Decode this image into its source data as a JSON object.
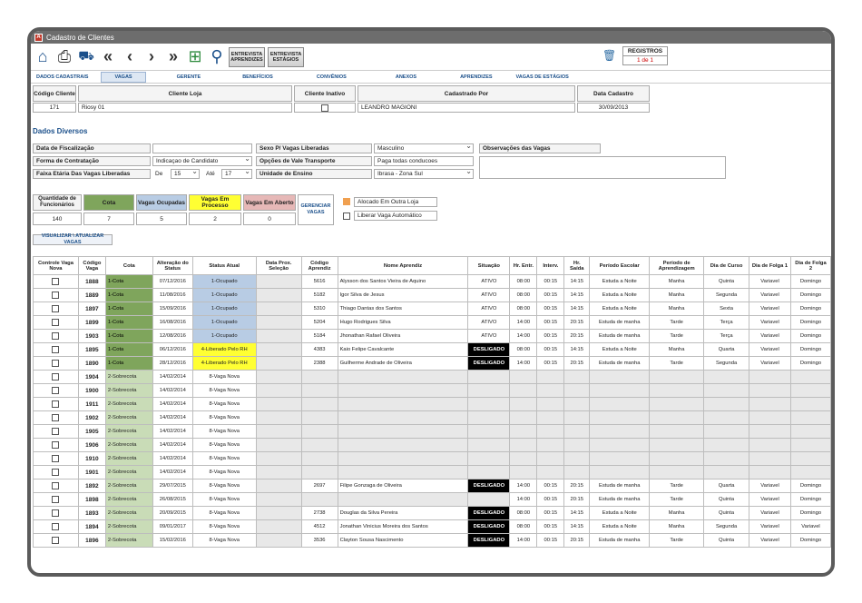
{
  "window": {
    "title": "Cadastro de Clientes"
  },
  "toolbar": {
    "icons": [
      "home-icon",
      "print-icon",
      "truck-icon",
      "first-icon",
      "prev-icon",
      "next-icon",
      "last-icon",
      "add-icon",
      "search-icon"
    ],
    "btn_entrevista_aprendizes": "ENTREVISTA APRENDIZES",
    "btn_entrevista_estagios": "ENTREVISTA ESTÁGIOS",
    "registros_label": "REGISTROS",
    "registros_value": "1 de 1"
  },
  "tabs": [
    "DADOS CADASTRAIS",
    "VAGAS",
    "GERENTE",
    "BENEFÍCIOS",
    "CONVÊNIOS",
    "ANEXOS",
    "APRENDIZES",
    "VAGAS DE ESTÁGIOS"
  ],
  "header": {
    "codigo_label": "Código Cliente",
    "codigo_value": "171",
    "cliente_label": "Cliente Loja",
    "cliente_value": "Riosy 01",
    "inativo_label": "Cliente Inativo",
    "cadastrado_label": "Cadastrado Por",
    "cadastrado_value": "LEANDRO MAGIONI",
    "data_label": "Data Cadastro",
    "data_value": "30/09/2013"
  },
  "dados": {
    "section_title": "Dados Diversos",
    "data_fiscalizacao_label": "Data de Fiscalização",
    "forma_label": "Forma de Contratação",
    "forma_value": "Indicaçao de Candidato",
    "faixa_label": "Faixa Etária Das Vagas Liberadas",
    "de_label": "De",
    "de_value": "15",
    "ate_label": "Até",
    "ate_value": "17",
    "sexo_label": "Sexo P/ Vagas Liberadas",
    "sexo_value": "Masculino",
    "vale_label": "Opções de Vale Transporte",
    "vale_value": "Paga todas conducoes",
    "unidade_label": "Unidade de Ensino",
    "unidade_value": "Ibrasa - Zona Sul",
    "obs_label": "Observações das Vagas"
  },
  "summary": {
    "qtd_label": "Quantidade de Funcionários",
    "qtd_value": "140",
    "cota_label": "Cota",
    "cota_value": "7",
    "ocupadas_label": "Vagas Ocupadas",
    "ocupadas_value": "5",
    "processo_label": "Vagas Em Processo",
    "processo_value": "2",
    "aberto_label": "Vagas Em Aberto",
    "aberto_value": "0",
    "gerenciar_label": "GERENCIAR VAGAS",
    "alocado_label": "Alocado Em Outra Loja",
    "liberar_label": "Liberar Vaga Automático",
    "visualizar_label": "VISUALIZAR \\ ATUALIZAR VAGAS"
  },
  "grid": {
    "headers": [
      "Controle Vaga Nova",
      "Código Vaga",
      "Cota",
      "Alteração do Status",
      "Status Atual",
      "Data Prox. Seleção",
      "Código Aprendiz",
      "Nome Aprendiz",
      "Situação",
      "Hr. Entr.",
      "Interv.",
      "Hr. Saída",
      "Período Escolar",
      "Período de Aprendizagem",
      "Dia de Curso",
      "Dia de Folga 1",
      "Dia de Folga 2"
    ],
    "rows": [
      [
        "1888",
        "1-Cota",
        "07/12/2016",
        "1-Ocupado",
        "",
        "5616",
        "Alysson dos Santos Vieira de Aquino",
        "ATIVO",
        "08:00",
        "00:15",
        "14:15",
        "Estuda a Noite",
        "Manha",
        "Quinta",
        "Variavel",
        "Domingo"
      ],
      [
        "1889",
        "1-Cota",
        "11/08/2016",
        "1-Ocupado",
        "",
        "5182",
        "Igor Silva de Jesus",
        "ATIVO",
        "08:00",
        "00:15",
        "14:15",
        "Estuda a Noite",
        "Manha",
        "Segunda",
        "Variavel",
        "Domingo"
      ],
      [
        "1897",
        "1-Cota",
        "15/09/2016",
        "1-Ocupado",
        "",
        "5310",
        "Thiago Dantas dos Santos",
        "ATIVO",
        "08:00",
        "00:15",
        "14:15",
        "Estuda a Noite",
        "Manha",
        "Sexta",
        "Variavel",
        "Domingo"
      ],
      [
        "1899",
        "1-Cota",
        "16/08/2016",
        "1-Ocupado",
        "",
        "5204",
        "Hugo Rodrigues Silva",
        "ATIVO",
        "14:00",
        "00:15",
        "20:15",
        "Estuda de manha",
        "Tarde",
        "Terça",
        "Variavel",
        "Domingo"
      ],
      [
        "1903",
        "1-Cota",
        "12/08/2016",
        "1-Ocupado",
        "",
        "5184",
        "Jhonathan Rafael Oliveira",
        "ATIVO",
        "14:00",
        "00:15",
        "20:15",
        "Estuda de manha",
        "Tarde",
        "Terça",
        "Variavel",
        "Domingo"
      ],
      [
        "1895",
        "1-Cota",
        "06/12/2016",
        "4-Liberado Pelo RH",
        "",
        "4383",
        "Kaio Felipe Cavalcante",
        "DESLIGADO",
        "08:00",
        "00:15",
        "14:15",
        "Estuda a Noite",
        "Manha",
        "Quarta",
        "Variavel",
        "Domingo"
      ],
      [
        "1890",
        "1-Cota",
        "28/12/2016",
        "4-Liberado Pelo RH",
        "",
        "2388",
        "Guilherme Andrade de Oliveira",
        "DESLIGADO",
        "14:00",
        "00:15",
        "20:15",
        "Estuda de manha",
        "Tarde",
        "Segunda",
        "Variavel",
        "Domingo"
      ],
      [
        "1904",
        "2-Sobrecota",
        "14/02/2014",
        "8-Vaga Nova",
        "",
        "",
        "",
        "",
        "",
        "",
        "",
        "",
        "",
        "",
        "",
        ""
      ],
      [
        "1900",
        "2-Sobrecota",
        "14/02/2014",
        "8-Vaga Nova",
        "",
        "",
        "",
        "",
        "",
        "",
        "",
        "",
        "",
        "",
        "",
        ""
      ],
      [
        "1911",
        "2-Sobrecota",
        "14/02/2014",
        "8-Vaga Nova",
        "",
        "",
        "",
        "",
        "",
        "",
        "",
        "",
        "",
        "",
        "",
        ""
      ],
      [
        "1902",
        "2-Sobrecota",
        "14/02/2014",
        "8-Vaga Nova",
        "",
        "",
        "",
        "",
        "",
        "",
        "",
        "",
        "",
        "",
        "",
        ""
      ],
      [
        "1905",
        "2-Sobrecota",
        "14/02/2014",
        "8-Vaga Nova",
        "",
        "",
        "",
        "",
        "",
        "",
        "",
        "",
        "",
        "",
        "",
        ""
      ],
      [
        "1906",
        "2-Sobrecota",
        "14/02/2014",
        "8-Vaga Nova",
        "",
        "",
        "",
        "",
        "",
        "",
        "",
        "",
        "",
        "",
        "",
        ""
      ],
      [
        "1910",
        "2-Sobrecota",
        "14/02/2014",
        "8-Vaga Nova",
        "",
        "",
        "",
        "",
        "",
        "",
        "",
        "",
        "",
        "",
        "",
        ""
      ],
      [
        "1901",
        "2-Sobrecota",
        "14/02/2014",
        "8-Vaga Nova",
        "",
        "",
        "",
        "",
        "",
        "",
        "",
        "",
        "",
        "",
        "",
        ""
      ],
      [
        "1892",
        "2-Sobrecota",
        "29/07/2015",
        "8-Vaga Nova",
        "",
        "2697",
        "Filipe Gonzaga de Oliveira",
        "DESLIGADO",
        "14:00",
        "00:15",
        "20:15",
        "Estuda de manha",
        "Tarde",
        "Quarta",
        "Variavel",
        "Domingo"
      ],
      [
        "1898",
        "2-Sobrecota",
        "26/08/2015",
        "8-Vaga Nova",
        "",
        "",
        "",
        "",
        "14:00",
        "00:15",
        "20:15",
        "Estuda de manha",
        "Tarde",
        "Quinta",
        "Variavel",
        "Domingo"
      ],
      [
        "1893",
        "2-Sobrecota",
        "20/09/2015",
        "8-Vaga Nova",
        "",
        "2738",
        "Douglas da Silva Pereira",
        "DESLIGADO",
        "08:00",
        "00:15",
        "14:15",
        "Estuda a Noite",
        "Manha",
        "Quinta",
        "Variavel",
        "Domingo"
      ],
      [
        "1894",
        "2-Sobrecota",
        "09/01/2017",
        "8-Vaga Nova",
        "",
        "4512",
        "Jonathan Vinicius Moreira dos Santos",
        "DESLIGADO",
        "08:00",
        "00:15",
        "14:15",
        "Estuda a Noite",
        "Manha",
        "Segunda",
        "Variavel",
        "Variavel"
      ],
      [
        "1896",
        "2-Sobrecota",
        "15/02/2016",
        "8-Vaga Nova",
        "",
        "3536",
        "Clayton Sousa Nascimento",
        "DESLIGADO",
        "14:00",
        "00:15",
        "20:15",
        "Estuda de manha",
        "Tarde",
        "Quinta",
        "Variavel",
        "Domingo"
      ]
    ]
  }
}
